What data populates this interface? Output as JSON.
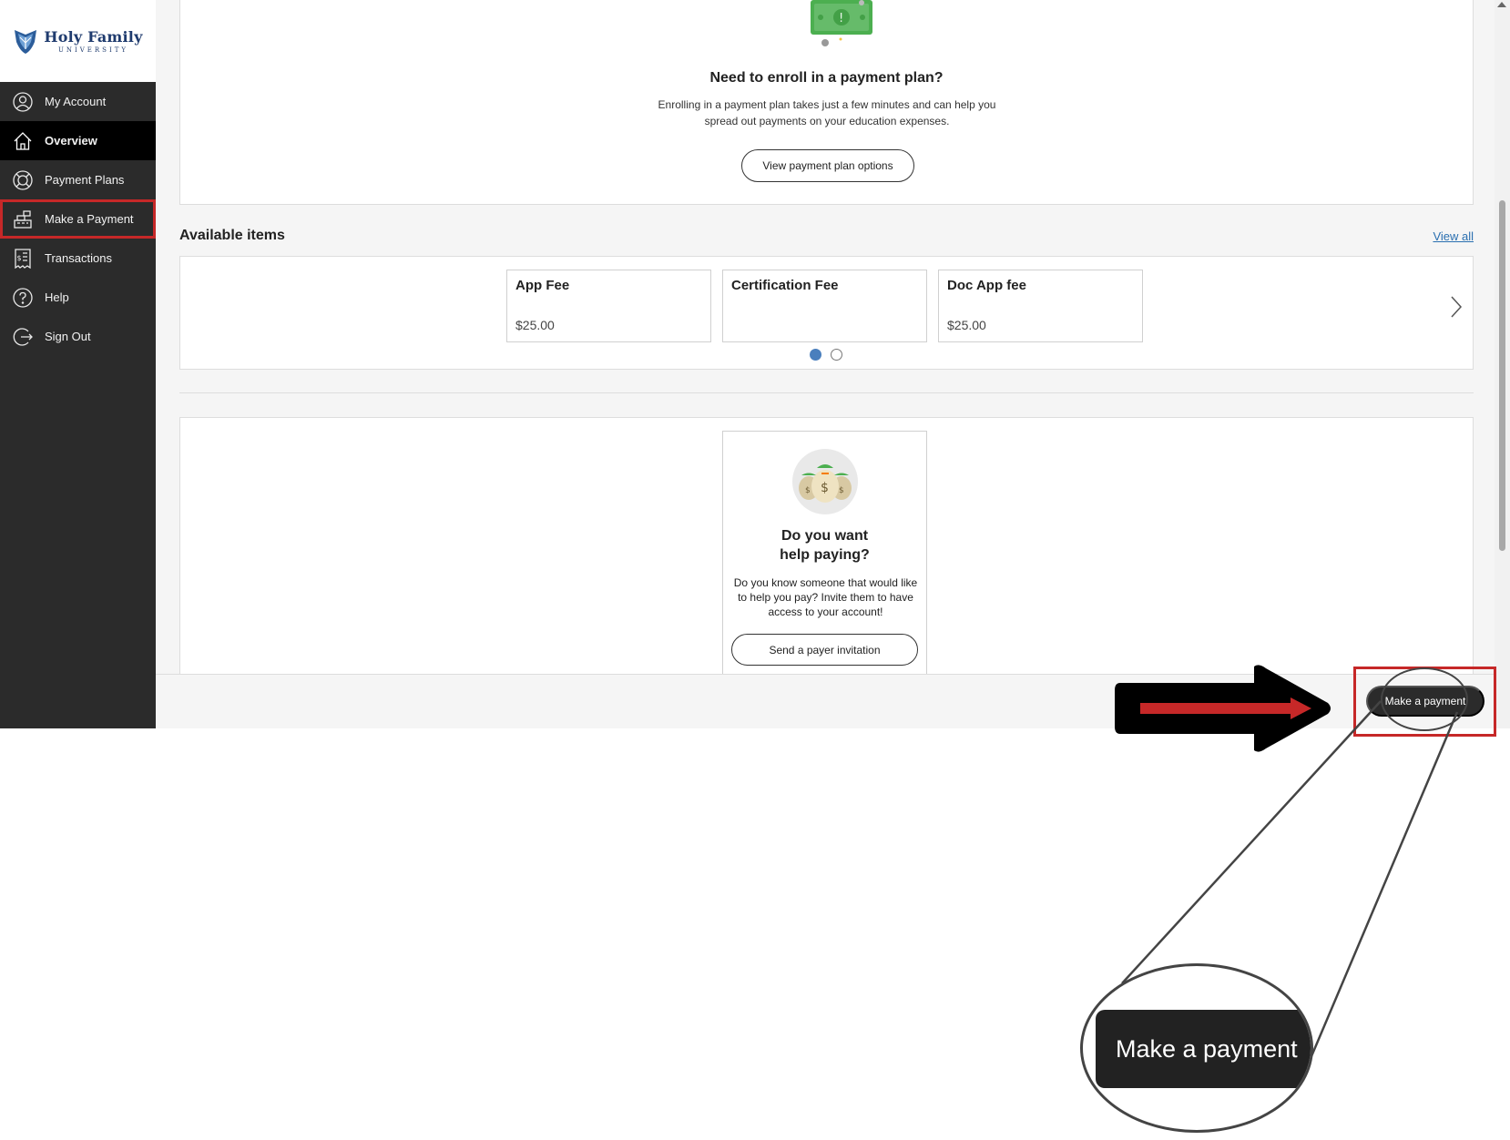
{
  "sidebar": {
    "logo": {
      "title": "Holy Family",
      "subtitle": "UNIVERSITY",
      "icon": "university-shield-logo"
    },
    "items": [
      {
        "label": "My Account",
        "icon": "user-circle-icon",
        "state": "normal"
      },
      {
        "label": "Overview",
        "icon": "home-icon",
        "state": "active"
      },
      {
        "label": "Payment Plans",
        "icon": "lifebuoy-icon",
        "state": "normal"
      },
      {
        "label": "Make a Payment",
        "icon": "cash-register-icon",
        "state": "highlighted"
      },
      {
        "label": "Transactions",
        "icon": "receipt-icon",
        "state": "normal"
      },
      {
        "label": "Help",
        "icon": "question-circle-icon",
        "state": "normal"
      },
      {
        "label": "Sign Out",
        "icon": "sign-out-icon",
        "state": "normal"
      }
    ]
  },
  "payment_plan": {
    "icon": "money-bill-icon",
    "heading": "Need to enroll in a payment plan?",
    "description": "Enrolling in a payment plan takes just a few minutes and can help you spread out payments on your education expenses.",
    "button": "View payment plan options"
  },
  "available_items": {
    "title": "Available items",
    "view_all": "View all",
    "cards": [
      {
        "title": "App Fee",
        "price": "$25.00"
      },
      {
        "title": "Certification Fee",
        "price": ""
      },
      {
        "title": "Doc App fee",
        "price": "$25.00"
      }
    ],
    "pagination": {
      "current_page": 1,
      "total_pages": 2
    },
    "next_icon": "chevron-right-icon"
  },
  "help_paying": {
    "icon": "money-bags-icon",
    "heading_line1": "Do you want",
    "heading_line2": "help paying?",
    "description": "Do you know someone that would like to help you pay? Invite them to have access to your account!",
    "button": "Send a payer invitation"
  },
  "footer": {
    "make_payment_button": "Make a payment"
  },
  "annotation": {
    "arrow_icon": "right-arrow-annotation",
    "zoom_label": "Make a payment",
    "highlight_color": "#c62828"
  },
  "colors": {
    "sidebar_bg": "#2b2b2b",
    "active_nav_bg": "#000000",
    "brand_blue": "#1f3b6e",
    "link_blue": "#2a6fb0",
    "dot_active": "#4a7fbd"
  }
}
